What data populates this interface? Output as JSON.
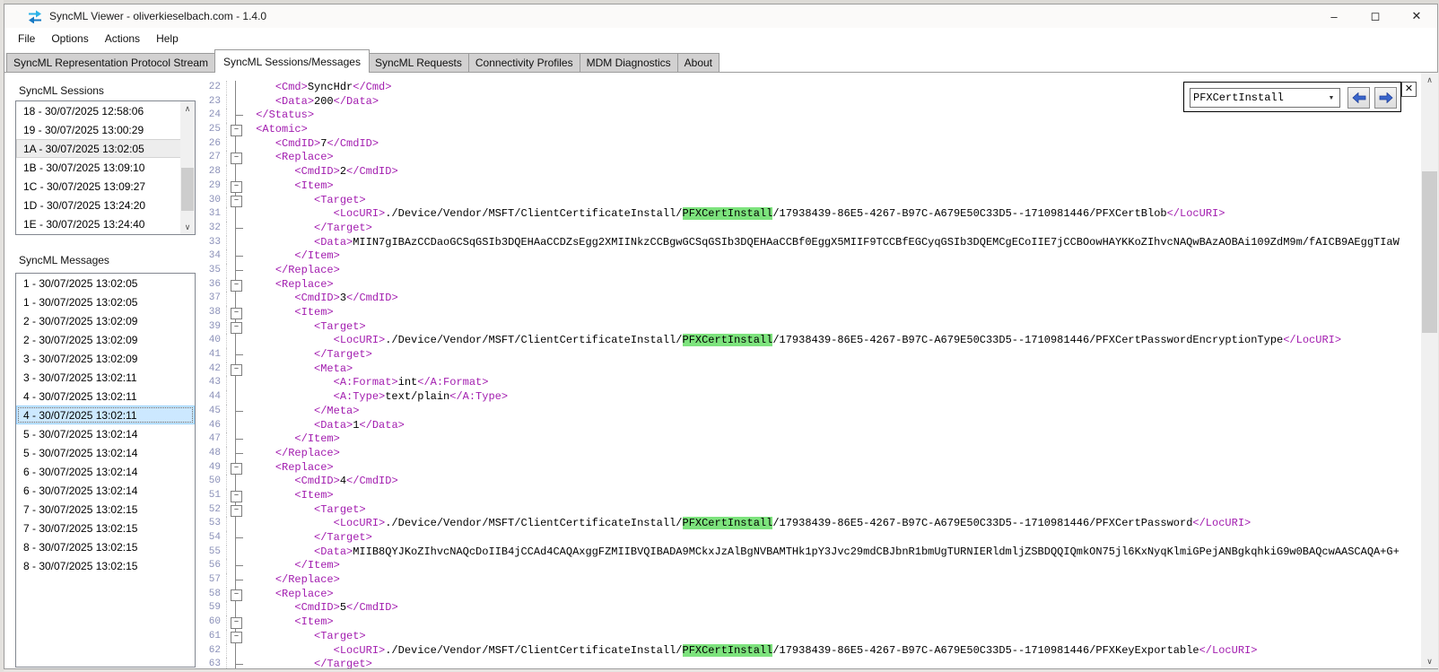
{
  "window": {
    "title": "SyncML Viewer - oliverkieselbach.com - 1.4.0",
    "controls": {
      "minimize": "–",
      "maximize": "◻",
      "close": "✕"
    }
  },
  "menu": {
    "items": [
      "File",
      "Options",
      "Actions",
      "Help"
    ]
  },
  "tabs": {
    "active_index": 1,
    "items": [
      "SyncML Representation Protocol Stream",
      "SyncML Sessions/Messages",
      "SyncML Requests",
      "Connectivity Profiles",
      "MDM Diagnostics",
      "About"
    ]
  },
  "sidebar": {
    "sessions_label": "SyncML Sessions",
    "sessions": [
      {
        "label": "18 - 30/07/2025 12:58:06",
        "state": "normal"
      },
      {
        "label": "19 - 30/07/2025 13:00:29",
        "state": "normal"
      },
      {
        "label": "1A - 30/07/2025 13:02:05",
        "state": "inactive-selected"
      },
      {
        "label": "1B - 30/07/2025 13:09:10",
        "state": "normal"
      },
      {
        "label": "1C - 30/07/2025 13:09:27",
        "state": "normal"
      },
      {
        "label": "1D - 30/07/2025 13:24:20",
        "state": "normal"
      },
      {
        "label": "1E - 30/07/2025 13:24:40",
        "state": "normal"
      }
    ],
    "messages_label": "SyncML Messages",
    "messages": [
      {
        "label": "1 - 30/07/2025 13:02:05",
        "state": "normal"
      },
      {
        "label": "1 - 30/07/2025 13:02:05",
        "state": "normal"
      },
      {
        "label": "2 - 30/07/2025 13:02:09",
        "state": "normal"
      },
      {
        "label": "2 - 30/07/2025 13:02:09",
        "state": "normal"
      },
      {
        "label": "3 - 30/07/2025 13:02:09",
        "state": "normal"
      },
      {
        "label": "3 - 30/07/2025 13:02:11",
        "state": "normal"
      },
      {
        "label": "4 - 30/07/2025 13:02:11",
        "state": "normal"
      },
      {
        "label": "4 - 30/07/2025 13:02:11",
        "state": "selected"
      },
      {
        "label": "5 - 30/07/2025 13:02:14",
        "state": "normal"
      },
      {
        "label": "5 - 30/07/2025 13:02:14",
        "state": "normal"
      },
      {
        "label": "6 - 30/07/2025 13:02:14",
        "state": "normal"
      },
      {
        "label": "6 - 30/07/2025 13:02:14",
        "state": "normal"
      },
      {
        "label": "7 - 30/07/2025 13:02:15",
        "state": "normal"
      },
      {
        "label": "7 - 30/07/2025 13:02:15",
        "state": "normal"
      },
      {
        "label": "8 - 30/07/2025 13:02:15",
        "state": "normal"
      },
      {
        "label": "8 - 30/07/2025 13:02:15",
        "state": "normal"
      }
    ]
  },
  "search": {
    "value": "PFXCertInstall",
    "combo_arrow": "▼",
    "close_label": "✕"
  },
  "editor": {
    "highlight_term": "PFXCertInstall",
    "lines": [
      {
        "n": 22,
        "fold": "line",
        "text": "    <Cmd>SyncHdr</Cmd>"
      },
      {
        "n": 23,
        "fold": "line",
        "text": "    <Data>200</Data>"
      },
      {
        "n": 24,
        "fold": "end",
        "text": " </Status>"
      },
      {
        "n": 25,
        "fold": "box",
        "text": " <Atomic>"
      },
      {
        "n": 26,
        "fold": "line",
        "text": "    <CmdID>7</CmdID>"
      },
      {
        "n": 27,
        "fold": "box",
        "text": "    <Replace>"
      },
      {
        "n": 28,
        "fold": "line",
        "text": "       <CmdID>2</CmdID>"
      },
      {
        "n": 29,
        "fold": "box",
        "text": "       <Item>"
      },
      {
        "n": 30,
        "fold": "box",
        "text": "          <Target>"
      },
      {
        "n": 31,
        "fold": "line",
        "text": "             <LocURI>./Device/Vendor/MSFT/ClientCertificateInstall/PFXCertInstall/17938439-86E5-4267-B97C-A679E50C33D5--1710981446/PFXCertBlob</LocURI>"
      },
      {
        "n": 32,
        "fold": "end",
        "text": "          </Target>"
      },
      {
        "n": 33,
        "fold": "line",
        "text": "          <Data>MIIN7gIBAzCCDaoGCSqGSIb3DQEHAaCCDZsEgg2XMIINkzCCBgwGCSqGSIb3DQEHAaCCBf0EggX5MIIF9TCCBfEGCyqGSIb3DQEMCgECoIIE7jCCBOowHAYKKoZIhvcNAQwBAzAOBAi109ZdM9m/fAICB9AEggTIaW"
      },
      {
        "n": 34,
        "fold": "end",
        "text": "       </Item>"
      },
      {
        "n": 35,
        "fold": "end",
        "text": "    </Replace>"
      },
      {
        "n": 36,
        "fold": "box",
        "text": "    <Replace>"
      },
      {
        "n": 37,
        "fold": "line",
        "text": "       <CmdID>3</CmdID>"
      },
      {
        "n": 38,
        "fold": "box",
        "text": "       <Item>"
      },
      {
        "n": 39,
        "fold": "box",
        "text": "          <Target>"
      },
      {
        "n": 40,
        "fold": "line",
        "text": "             <LocURI>./Device/Vendor/MSFT/ClientCertificateInstall/PFXCertInstall/17938439-86E5-4267-B97C-A679E50C33D5--1710981446/PFXCertPasswordEncryptionType</LocURI>"
      },
      {
        "n": 41,
        "fold": "end",
        "text": "          </Target>"
      },
      {
        "n": 42,
        "fold": "box",
        "text": "          <Meta>"
      },
      {
        "n": 43,
        "fold": "line",
        "text": "             <A:Format>int</A:Format>"
      },
      {
        "n": 44,
        "fold": "line",
        "text": "             <A:Type>text/plain</A:Type>"
      },
      {
        "n": 45,
        "fold": "end",
        "text": "          </Meta>"
      },
      {
        "n": 46,
        "fold": "line",
        "text": "          <Data>1</Data>"
      },
      {
        "n": 47,
        "fold": "end",
        "text": "       </Item>"
      },
      {
        "n": 48,
        "fold": "end",
        "text": "    </Replace>"
      },
      {
        "n": 49,
        "fold": "box",
        "text": "    <Replace>"
      },
      {
        "n": 50,
        "fold": "line",
        "text": "       <CmdID>4</CmdID>"
      },
      {
        "n": 51,
        "fold": "box",
        "text": "       <Item>"
      },
      {
        "n": 52,
        "fold": "box",
        "text": "          <Target>"
      },
      {
        "n": 53,
        "fold": "line",
        "text": "             <LocURI>./Device/Vendor/MSFT/ClientCertificateInstall/PFXCertInstall/17938439-86E5-4267-B97C-A679E50C33D5--1710981446/PFXCertPassword</LocURI>"
      },
      {
        "n": 54,
        "fold": "end",
        "text": "          </Target>"
      },
      {
        "n": 55,
        "fold": "line",
        "text": "          <Data>MIIB8QYJKoZIhvcNAQcDoIIB4jCCAd4CAQAxggFZMIIBVQIBADA9MCkxJzAlBgNVBAMTHk1pY3Jvc29mdCBJbnR1bmUgTURNIERldmljZSBDQQIQmkON75jl6KxNyqKlmiGPejANBgkqhkiG9w0BAQcwAASCAQA+G+"
      },
      {
        "n": 56,
        "fold": "end",
        "text": "       </Item>"
      },
      {
        "n": 57,
        "fold": "end",
        "text": "    </Replace>"
      },
      {
        "n": 58,
        "fold": "box",
        "text": "    <Replace>"
      },
      {
        "n": 59,
        "fold": "line",
        "text": "       <CmdID>5</CmdID>"
      },
      {
        "n": 60,
        "fold": "box",
        "text": "       <Item>"
      },
      {
        "n": 61,
        "fold": "box",
        "text": "          <Target>"
      },
      {
        "n": 62,
        "fold": "line",
        "text": "             <LocURI>./Device/Vendor/MSFT/ClientCertificateInstall/PFXCertInstall/17938439-86E5-4267-B97C-A679E50C33D5--1710981446/PFXKeyExportable</LocURI>"
      },
      {
        "n": 63,
        "fold": "end",
        "text": "          </Target>"
      }
    ]
  },
  "colors": {
    "tag": "#a21caf",
    "highlight_bg": "#7de37d",
    "selection_bg": "#cce8ff",
    "selection_border": "#99d1ff",
    "line_number": "#8a90b8",
    "icon_blue_light": "#2bb2e8",
    "icon_blue_dark": "#1779c4",
    "find_arrow_blue": "#3a66cc"
  }
}
